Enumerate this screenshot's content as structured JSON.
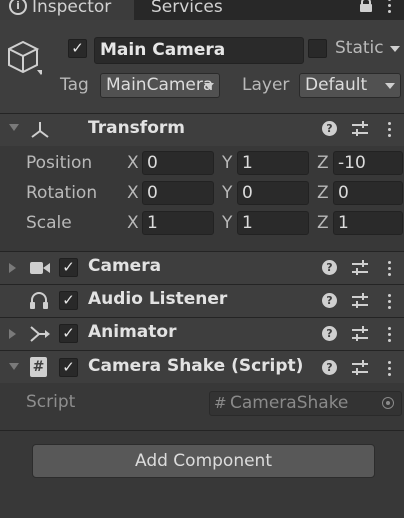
{
  "tabs": [
    {
      "label": "Inspector",
      "active": true
    },
    {
      "label": "Services",
      "active": false
    }
  ],
  "header": {
    "object_name": "Main Camera",
    "active": true,
    "static_label": "Static",
    "static_checked": false,
    "tag_label": "Tag",
    "tag_value": "MainCamera",
    "layer_label": "Layer",
    "layer_value": "Default"
  },
  "transform": {
    "title": "Transform",
    "rows": [
      {
        "label": "Position",
        "x": "0",
        "y": "1",
        "z": "-10"
      },
      {
        "label": "Rotation",
        "x": "0",
        "y": "0",
        "z": "0"
      },
      {
        "label": "Scale",
        "x": "1",
        "y": "1",
        "z": "1"
      }
    ],
    "axes": [
      "X",
      "Y",
      "Z"
    ]
  },
  "components": [
    {
      "title": "Camera",
      "icon": "camera-icon",
      "enabled": true,
      "expanded": false
    },
    {
      "title": "Audio Listener",
      "icon": "headphones-icon",
      "enabled": true,
      "expanded": false
    },
    {
      "title": "Animator",
      "icon": "animator-icon",
      "enabled": true,
      "expanded": false
    },
    {
      "title": "Camera Shake (Script)",
      "icon": "script-icon",
      "enabled": true,
      "expanded": true
    }
  ],
  "script": {
    "label": "Script",
    "value": "CameraShake"
  },
  "add_component_label": "Add Component",
  "colors": {
    "background": "#383838",
    "header": "#3e3e3e",
    "field": "#2a2a2a"
  }
}
